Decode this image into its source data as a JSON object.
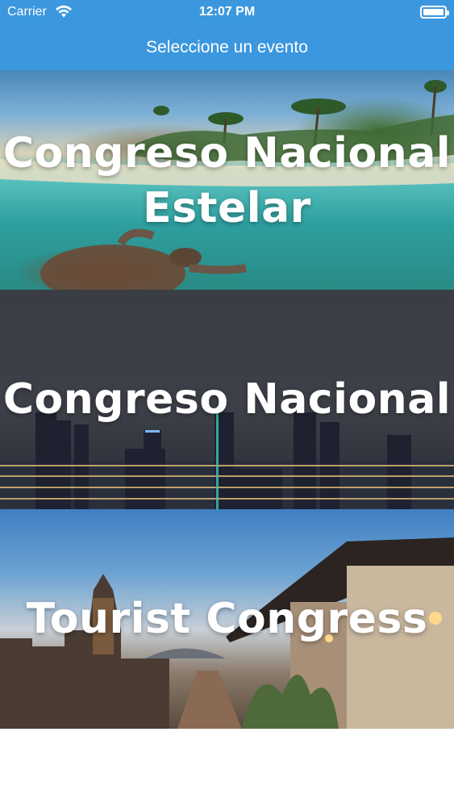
{
  "status_bar": {
    "carrier": "Carrier",
    "time": "12:07 PM"
  },
  "nav": {
    "title": "Seleccione un evento"
  },
  "events": [
    {
      "title_line1": "Congreso Nacional",
      "title_line2": "Estelar"
    },
    {
      "title_line1": "Congreso Nacional"
    },
    {
      "title_line1": "Tourist Congress"
    }
  ],
  "colors": {
    "bar_background": "#3b97de",
    "text": "#ffffff"
  }
}
